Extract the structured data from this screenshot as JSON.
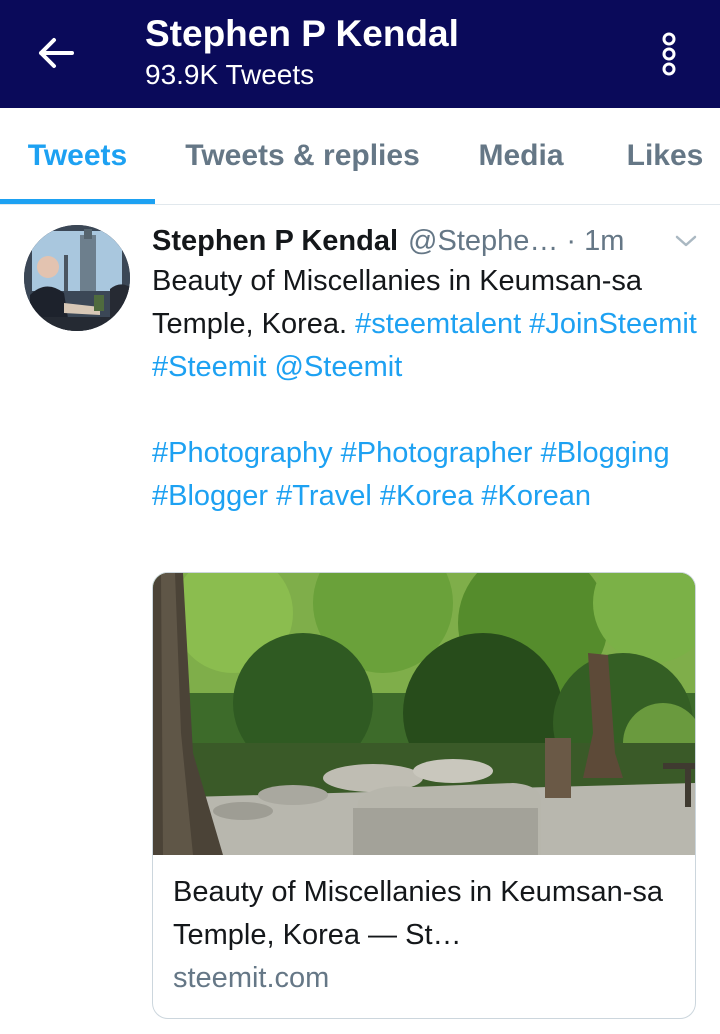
{
  "header": {
    "title": "Stephen P Kendal",
    "subtitle": "93.9K Tweets",
    "back_icon": "arrow-left-icon",
    "more_icon": "more-vertical-icon",
    "background_color": "#0a0a5a"
  },
  "tabs": [
    {
      "label": "Tweets",
      "active": true
    },
    {
      "label": "Tweets & replies",
      "active": false
    },
    {
      "label": "Media",
      "active": false
    },
    {
      "label": "Likes",
      "active": false
    }
  ],
  "accent_color": "#1da1f2",
  "tweet": {
    "name": "Stephen P Kendal",
    "handle": "@Stephe…",
    "separator": "·",
    "time": "1m",
    "text_line1": "Beauty of Miscellanies in Keumsan-sa Temple, Korea.",
    "tags_line1": [
      "#steemtalent",
      "#JoinSteemit",
      "#Steemit",
      "@Steemit"
    ],
    "tags_line2": [
      "#Photography",
      "#Photographer",
      "#Blogging",
      "#Blogger",
      "#Travel",
      "#Korea",
      "#Korean"
    ],
    "card": {
      "title": "Beauty of Miscellanies in Keumsan-sa Temple, Korea — St…",
      "domain": "steemit.com"
    }
  }
}
